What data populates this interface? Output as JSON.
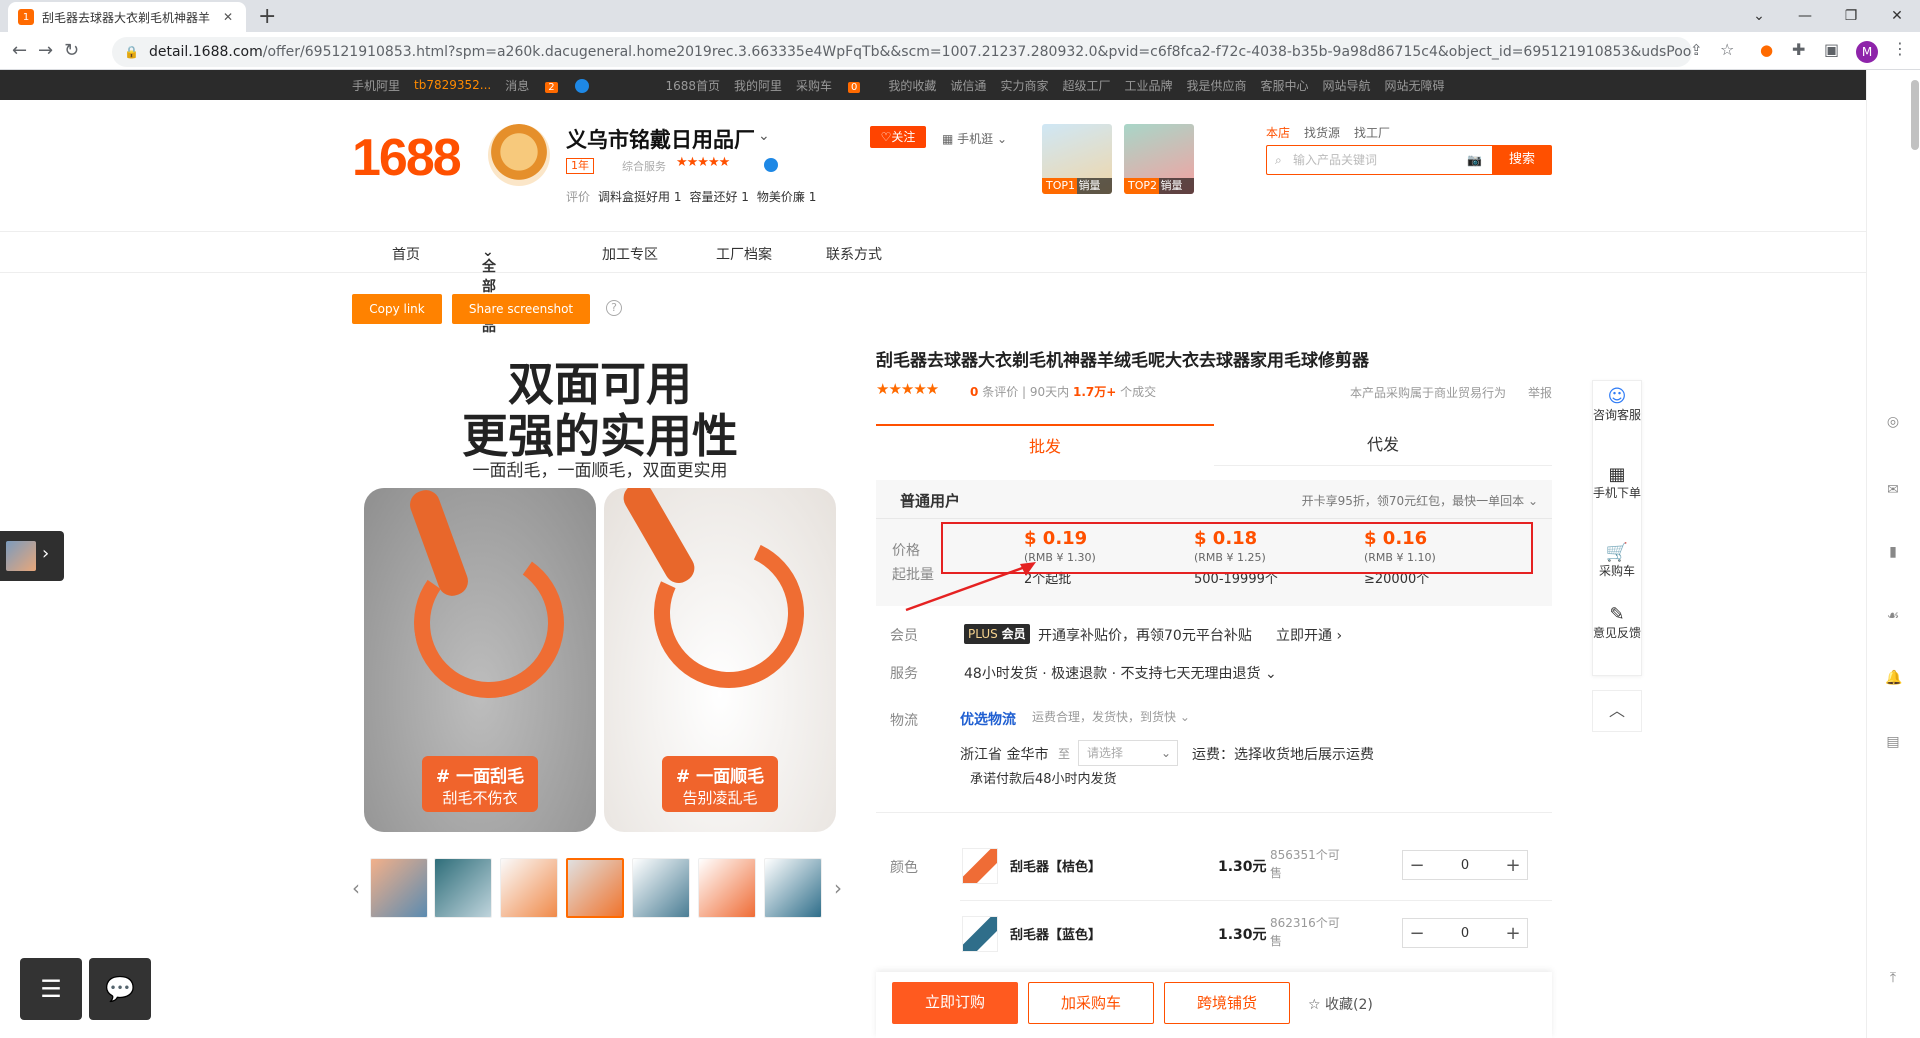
{
  "browser": {
    "tab_title": "刮毛器去球器大衣剃毛机神器羊",
    "new_tab": "+",
    "url_host": "detail.1688.com",
    "url_path": "/offer/695121910853.html?spm=a260k.dacugeneral.home2019rec.3.663335e4WpFqTb&&scm=1007.21237.280932.0&pvid=c6f8fca2-f72c-4038-b35b-9a98d86715c4&object_id=695121910853&udsPoolId=22745...",
    "profile_initial": "M"
  },
  "site_bar": {
    "items": [
      "手机阿里",
      "tb7829352...",
      "消息",
      "1688首页",
      "我的阿里",
      "采购车",
      "我的收藏",
      "诚信通",
      "实力商家",
      "超级工厂",
      "工业品牌",
      "我是供应商",
      "客服中心",
      "网站导航",
      "网站无障碍"
    ],
    "msg_count": "2",
    "cart_count": "0"
  },
  "shop": {
    "logo": "1688",
    "name": "义乌市铭戴日用品厂",
    "year": "1年",
    "service_label": "综合服务",
    "stars": "★★★★★",
    "review_label": "评价",
    "reviews": [
      "调料盒挺好用 1",
      "容量还好 1",
      "物美价廉 1"
    ],
    "follow": "关注",
    "mobile_shop": "手机逛",
    "top1": "TOP1 销量",
    "top2": "TOP2 销量",
    "search_tabs": [
      "本店",
      "找货源",
      "找工厂"
    ],
    "search_placeholder": "输入产品关键词",
    "search_button": "搜索"
  },
  "shop_nav": {
    "items": [
      "首页",
      "全部商品",
      "加工专区",
      "工厂档案",
      "联系方式"
    ]
  },
  "tools": {
    "copy_link": "Copy link",
    "share_screenshot": "Share screenshot",
    "help": "?"
  },
  "gallery": {
    "headline1": "双面可用",
    "headline2": "更强的实用性",
    "subhead": "一面刮毛，一面顺毛，双面更实用",
    "tag1_a": "# 一面刮毛",
    "tag1_b": "刮毛不伤衣",
    "tag2_a": "# 一面顺毛",
    "tag2_b": "告别凌乱毛"
  },
  "product": {
    "title": "刮毛器去球器大衣剃毛机神器羊绒毛呢大衣去球器家用毛球修剪器",
    "stars": "★★★★★",
    "review_count": "0",
    "review_label": "条评价",
    "period": "90天内",
    "sold": "1.7万+",
    "sold_label": "个成交",
    "legal": "本产品采购属于商业贸易行为",
    "report": "举报",
    "tab_wholesale": "批发",
    "tab_dropship": "代发",
    "user_type": "普通用户",
    "user_promo": "开卡享95折，领70元红包，最快一单回本",
    "price_label": "价格",
    "moq_label": "起批量",
    "tiers": [
      {
        "usd": "$ 0.19",
        "rmb": "(RMB ¥ 1.30)",
        "moq": "2个起批"
      },
      {
        "usd": "$ 0.18",
        "rmb": "(RMB ¥ 1.25)",
        "moq": "500-19999个"
      },
      {
        "usd": "$ 0.16",
        "rmb": "(RMB ¥ 1.10)",
        "moq": "≥20000个"
      }
    ],
    "member_label": "会员",
    "plus_badge_a": "PLUS",
    "plus_badge_b": "会员",
    "member_text": "开通享补贴价，再领70元平台补贴",
    "member_action": "立即开通",
    "service_label": "服务",
    "service_text": "48小时发货 · 极速退款 · 不支持七天无理由退货",
    "logistics_label": "物流",
    "logistics_brand": "优选物流",
    "logistics_sub": "运费合理，发货快，到货快",
    "origin": "浙江省 金华市",
    "to": "至",
    "dest_placeholder": "请选择",
    "freight": "运费：选择收货地后展示运费",
    "ship_promise": "承诺付款后48小时内发货",
    "color_label": "颜色"
  },
  "skus": [
    {
      "name": "刮毛器【桔色】",
      "price": "1.30元",
      "stock": "856351个可售",
      "qty": "0"
    },
    {
      "name": "刮毛器【蓝色】",
      "price": "1.30元",
      "stock": "862316个可售",
      "qty": "0"
    }
  ],
  "actions": {
    "buy": "立即订购",
    "cart": "加采购车",
    "cross": "跨境铺货",
    "fav": "收藏(2)"
  },
  "float": {
    "consult": "咨询客服",
    "mobile_order": "手机下单",
    "cart": "采购车",
    "feedback": "意见反馈"
  }
}
